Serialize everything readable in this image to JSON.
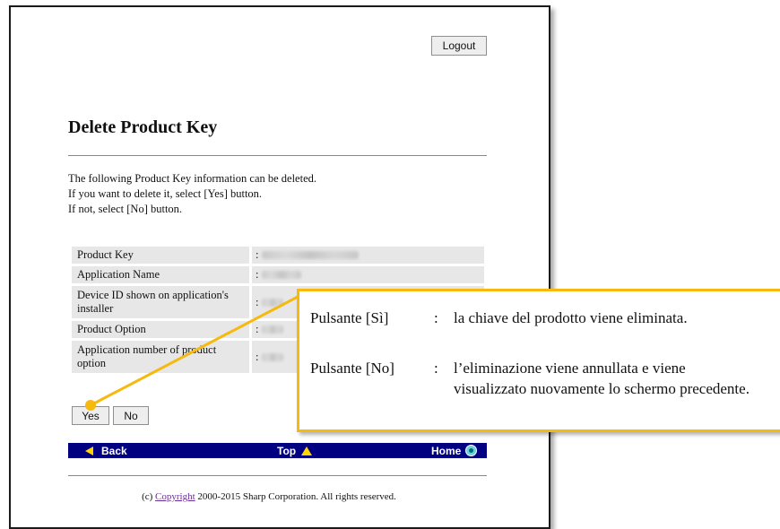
{
  "header": {
    "logout_label": "Logout"
  },
  "page": {
    "title": "Delete Product Key",
    "intro": [
      "The following Product Key information can be deleted.",
      "If you want to delete it, select [Yes] button.",
      "If not, select [No] button."
    ]
  },
  "info_rows": [
    {
      "label": "Product Key",
      "value": ":"
    },
    {
      "label": "Application Name",
      "value": ":"
    },
    {
      "label": "Device ID shown on application's installer",
      "value": ":"
    },
    {
      "label": "Product Option",
      "value": ":"
    },
    {
      "label": "Application number of product option",
      "value": ":"
    }
  ],
  "buttons": {
    "yes": "Yes",
    "no": "No"
  },
  "nav": {
    "back": "Back",
    "top": "Top",
    "home": "Home"
  },
  "footer": {
    "prefix": "(c) ",
    "link": "Copyright",
    "suffix": " 2000-2015 Sharp Corporation. All rights reserved."
  },
  "callout": {
    "yes_label": "Pulsante [Sì]",
    "yes_sep": ":",
    "yes_text": "la chiave del prodotto viene eliminata.",
    "no_label": "Pulsante [No]",
    "no_sep": ":",
    "no_text": "l’eliminazione viene annullata e viene visualizzato nuovamente lo schermo precedente."
  },
  "colors": {
    "nav_bar": "#000080",
    "callout_border": "#f6b90f",
    "arrow": "#ffd400"
  }
}
